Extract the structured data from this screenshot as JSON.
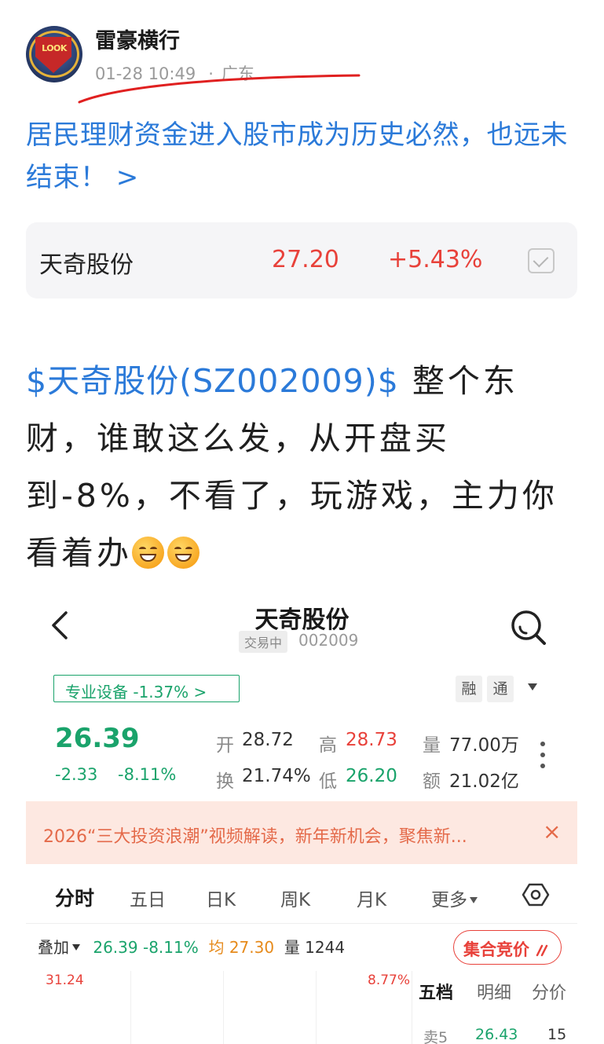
{
  "post": {
    "author": "雷豪横行",
    "avatar_text": "LOOK",
    "time": "01-28 10:49",
    "separator": "·",
    "location": "广东",
    "headline": "居民理财资金进入股市成为历史必然，也远未结束！ >",
    "colors": {
      "link": "#2b7ad9",
      "up": "#e8413a",
      "down": "#1aa36b",
      "annotation": "#e02020"
    }
  },
  "stock_card": {
    "name": "天奇股份",
    "price": "27.20",
    "change_pct": "+5.43%",
    "check_icon": "checkbox-icon"
  },
  "body": {
    "tag": "$天奇股份(SZ002009)$",
    "text": " 整个东财，谁敢这么发，从开盘买到-8%，不看了，玩游戏，主力你看着办",
    "emojis": [
      "grinning-face-icon",
      "beaming-face-icon"
    ]
  },
  "screenshot": {
    "title": "天奇股份",
    "status_badge": "交易中",
    "code": "002009",
    "sector": "专业设备 -1.37% >",
    "buttons": [
      "融",
      "通"
    ],
    "price": "26.39",
    "change": "-2.33",
    "change_pct": "-8.11%",
    "stats": {
      "open_label": "开",
      "open": "28.72",
      "high_label": "高",
      "high": "28.73",
      "volume_label": "量",
      "volume": "77.00万",
      "turnover_label": "换",
      "turnover": "21.74%",
      "low_label": "低",
      "low": "26.20",
      "amount_label": "额",
      "amount": "21.02亿"
    },
    "banner": {
      "text": "2026“三大投资浪潮”视频解读，新年新机会，聚焦新...",
      "close": "×"
    },
    "tabs": [
      "分时",
      "五日",
      "日K",
      "周K",
      "月K",
      "更多"
    ],
    "overlay": {
      "label": "叠加",
      "price": "26.39",
      "pct": "-8.11%",
      "avg_label": "均",
      "avg": "27.30",
      "vol_label": "量",
      "vol": "1244",
      "auction": "集合竞价"
    },
    "chart_axis": {
      "high": "31.24",
      "high_pct": "8.77%"
    },
    "side_tabs": [
      "五档",
      "明细",
      "分价"
    ],
    "side_row": {
      "label": "卖5",
      "price": "26.43",
      "qty": "15"
    }
  }
}
